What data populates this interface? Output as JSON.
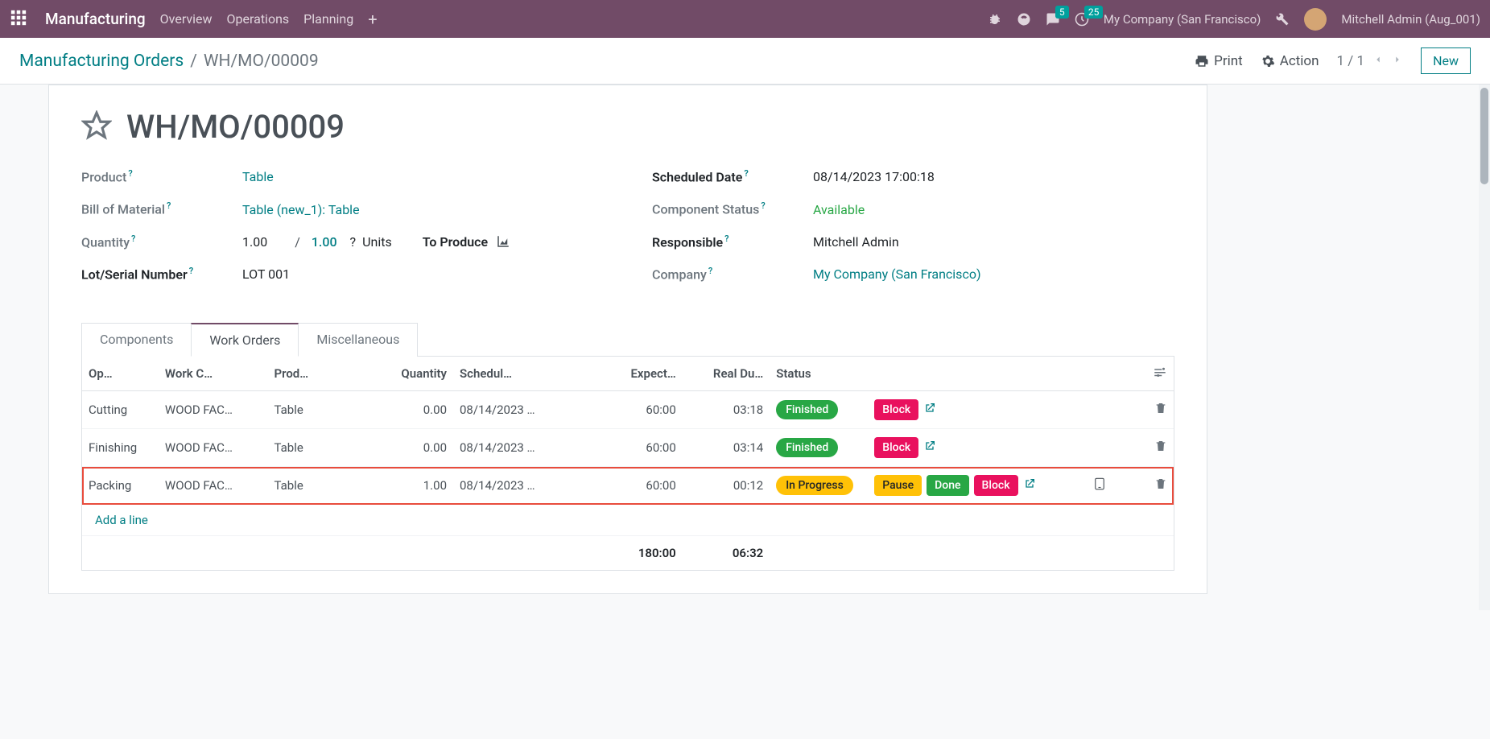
{
  "topbar": {
    "app_name": "Manufacturing",
    "menu": [
      "Overview",
      "Operations",
      "Planning"
    ],
    "msg_badge": "5",
    "activity_badge": "25",
    "company": "My Company (San Francisco)",
    "username": "Mitchell Admin (Aug_001)"
  },
  "breadcrumb": {
    "link": "Manufacturing Orders",
    "current": "WH/MO/00009"
  },
  "actions": {
    "print": "Print",
    "action": "Action",
    "pager": "1 / 1",
    "new": "New"
  },
  "record": {
    "title": "WH/MO/00009",
    "fields_left": {
      "product_label": "Product",
      "product_value": "Table",
      "bom_label": "Bill of Material",
      "bom_value": "Table (new_1): Table",
      "quantity_label": "Quantity",
      "quantity_value": "1.00",
      "quantity_target": "1.00",
      "quantity_unit": "Units",
      "to_produce": "To Produce",
      "lot_label": "Lot/Serial Number",
      "lot_value": "LOT 001"
    },
    "fields_right": {
      "scheduled_label": "Scheduled Date",
      "scheduled_value": "08/14/2023 17:00:18",
      "component_status_label": "Component Status",
      "component_status_value": "Available",
      "responsible_label": "Responsible",
      "responsible_value": "Mitchell Admin",
      "company_label": "Company",
      "company_value": "My Company (San Francisco)"
    }
  },
  "tabs": [
    "Components",
    "Work Orders",
    "Miscellaneous"
  ],
  "table": {
    "headers": {
      "operation": "Op…",
      "work_center": "Work C…",
      "product": "Prod…",
      "quantity": "Quantity",
      "scheduled": "Schedul…",
      "expected": "Expect…",
      "real_duration": "Real Du…",
      "status": "Status"
    },
    "rows": [
      {
        "operation": "Cutting",
        "work_center": "WOOD FAC…",
        "product": "Table",
        "quantity": "0.00",
        "scheduled": "08/14/2023 …",
        "expected": "60:00",
        "real_duration": "03:18",
        "status": "Finished",
        "status_class": "finished",
        "buttons": [
          "Block"
        ],
        "highlighted": false
      },
      {
        "operation": "Finishing",
        "work_center": "WOOD FAC…",
        "product": "Table",
        "quantity": "0.00",
        "scheduled": "08/14/2023 …",
        "expected": "60:00",
        "real_duration": "03:14",
        "status": "Finished",
        "status_class": "finished",
        "buttons": [
          "Block"
        ],
        "highlighted": false
      },
      {
        "operation": "Packing",
        "work_center": "WOOD FAC…",
        "product": "Table",
        "quantity": "1.00",
        "scheduled": "08/14/2023 …",
        "expected": "60:00",
        "real_duration": "00:12",
        "status": "In Progress",
        "status_class": "inprogress",
        "buttons": [
          "Pause",
          "Done",
          "Block"
        ],
        "highlighted": true
      }
    ],
    "add_line": "Add a line",
    "totals": {
      "expected": "180:00",
      "real_duration": "06:32"
    }
  },
  "buttons": {
    "block": "Block",
    "pause": "Pause",
    "done": "Done"
  }
}
